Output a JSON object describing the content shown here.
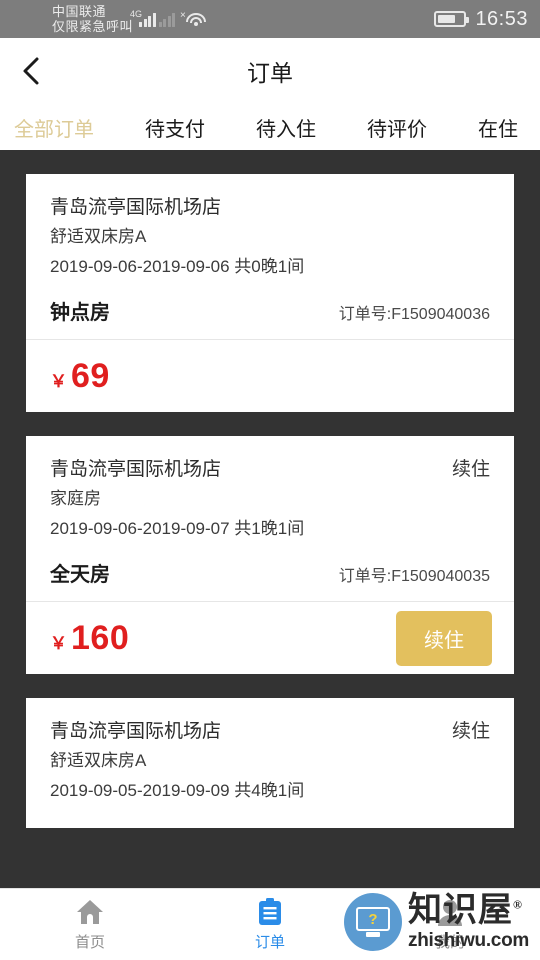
{
  "statusbar": {
    "carrier_line1": "中国联通",
    "carrier_line2": "仅限紧急呼叫",
    "network_type": "4G",
    "sim2_state": "×",
    "wifi_icon": "wifi-icon",
    "battery_icon": "battery-icon",
    "time": "16:53"
  },
  "header": {
    "back_icon": "back-chevron-icon",
    "title": "订单"
  },
  "tabs": [
    {
      "label": "全部订单",
      "active": true
    },
    {
      "label": "待支付",
      "active": false
    },
    {
      "label": "待入住",
      "active": false
    },
    {
      "label": "待评价",
      "active": false
    },
    {
      "label": "在住",
      "active": false
    }
  ],
  "orders": [
    {
      "hotel": "青岛流亭国际机场店",
      "status_tag": "",
      "room_type": "舒适双床房A",
      "dates": "2019-09-06-2019-09-06 共0晚1间",
      "plan": "钟点房",
      "order_no": "订单号:F1509040036",
      "currency": "￥",
      "price": "69",
      "action_label": ""
    },
    {
      "hotel": "青岛流亭国际机场店",
      "status_tag": "续住",
      "room_type": "家庭房",
      "dates": "2019-09-06-2019-09-07 共1晚1间",
      "plan": "全天房",
      "order_no": "订单号:F1509040035",
      "currency": "￥",
      "price": "160",
      "action_label": "续住"
    },
    {
      "hotel": "青岛流亭国际机场店",
      "status_tag": "续住",
      "room_type": "舒适双床房A",
      "dates": "2019-09-05-2019-09-09 共4晚1间",
      "plan": "",
      "order_no": "",
      "currency": "",
      "price": "",
      "action_label": ""
    }
  ],
  "bottomnav": [
    {
      "label": "首页",
      "icon": "home-icon",
      "active": false
    },
    {
      "label": "订单",
      "icon": "clipboard-icon",
      "active": true
    },
    {
      "label": "我的",
      "icon": "person-icon",
      "active": false
    }
  ],
  "watermark": {
    "brand_cn": "知识屋",
    "registered": "®",
    "url": "zhishiwu.com",
    "logo_icon": "monitor-question-icon",
    "logo_glyph": "?"
  },
  "colors": {
    "accent_gold": "#e3c05e",
    "tab_active": "#ddcb97",
    "price_red": "#e01f1f",
    "nav_active_blue": "#2b8ce8",
    "page_bg": "#333333",
    "statusbar_bg": "#7d7d7d"
  }
}
